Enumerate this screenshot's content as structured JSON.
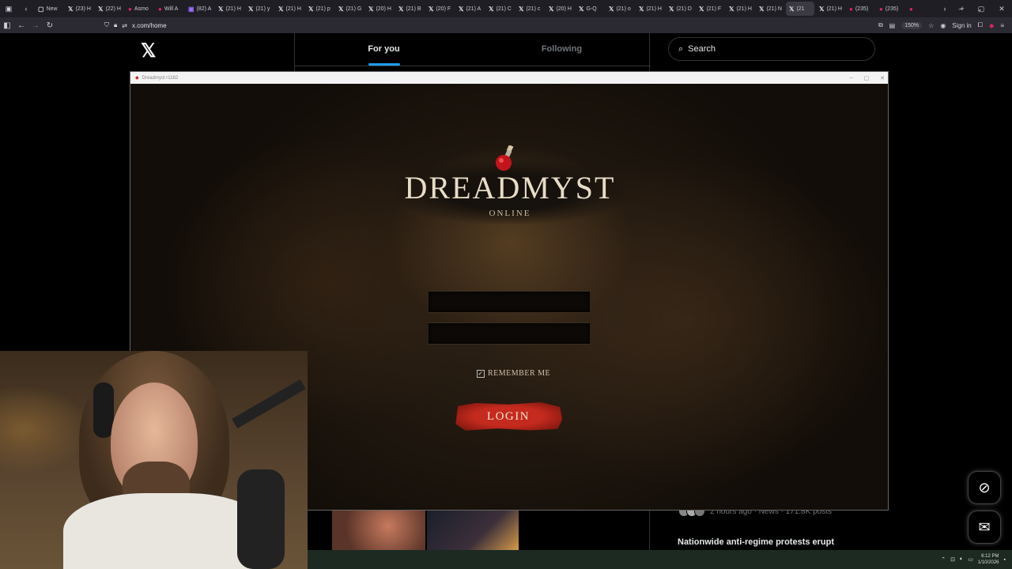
{
  "browser": {
    "tabs": [
      {
        "icon": "▢",
        "label": "New"
      },
      {
        "icon": "𝕏",
        "label": "(23) H"
      },
      {
        "icon": "𝕏",
        "label": "(22) H"
      },
      {
        "icon": "●",
        "label": "Asmo"
      },
      {
        "icon": "●",
        "label": "Will A"
      },
      {
        "icon": "▣",
        "label": "(82) A"
      },
      {
        "icon": "𝕏",
        "label": "(21) H"
      },
      {
        "icon": "𝕏",
        "label": "(21) y"
      },
      {
        "icon": "𝕏",
        "label": "(21) H"
      },
      {
        "icon": "𝕏",
        "label": "(21) p"
      },
      {
        "icon": "𝕏",
        "label": "(21) G"
      },
      {
        "icon": "𝕏",
        "label": "(20) H"
      },
      {
        "icon": "𝕏",
        "label": "(21) B"
      },
      {
        "icon": "𝕏",
        "label": "(20) F"
      },
      {
        "icon": "𝕏",
        "label": "(21) A"
      },
      {
        "icon": "𝕏",
        "label": "(21) C"
      },
      {
        "icon": "𝕏",
        "label": "(21) c"
      },
      {
        "icon": "𝕏",
        "label": "(20) H"
      },
      {
        "icon": "𝕏",
        "label": "G-Q"
      },
      {
        "icon": "𝕏",
        "label": "(21) o"
      },
      {
        "icon": "𝕏",
        "label": "(21) H"
      },
      {
        "icon": "𝕏",
        "label": "(21) D"
      },
      {
        "icon": "𝕏",
        "label": "(21) F"
      },
      {
        "icon": "𝕏",
        "label": "(21) H"
      },
      {
        "icon": "𝕏",
        "label": "(21) N"
      },
      {
        "icon": "𝕏",
        "label": "(21"
      },
      {
        "icon": "𝕏",
        "label": "(21) H"
      },
      {
        "icon": "●",
        "label": "(235)"
      },
      {
        "icon": "●",
        "label": "(235)"
      },
      {
        "icon": "●",
        "label": ""
      }
    ],
    "url": "x.com/home",
    "zoom": "150%",
    "sign_in": "Sign in"
  },
  "x": {
    "logo": "𝕏",
    "tab_for_you": "For you",
    "tab_following": "Following",
    "search_placeholder": "Search",
    "trend_meta": "2 hours ago · News · 171.8K posts",
    "trend_title": "Nationwide anti-regime protests erupt"
  },
  "game": {
    "window_title": "Dreadmyst r1182",
    "logo_title": "DREADMYST",
    "logo_subtitle": "ONLINE",
    "username_value": "",
    "password_value": "",
    "remember_me_label": "REMEMBER ME",
    "remember_me_checked": true,
    "login_label": "LOGIN"
  },
  "taskbar": {
    "time": "6:12 PM",
    "date": "1/10/2026"
  },
  "colors": {
    "accent": "#1d9bf0",
    "login_red": "#c52a1e",
    "taskbar": "#1c2a22"
  }
}
